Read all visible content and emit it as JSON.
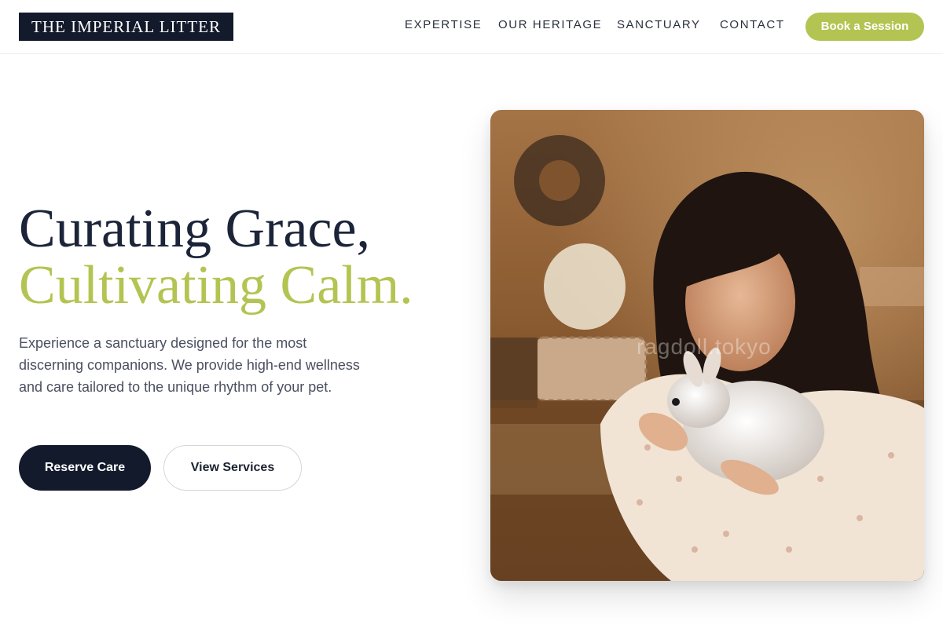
{
  "header": {
    "logo": "THE IMPERIAL LITTER",
    "nav": [
      "EXPERTISE",
      "OUR HERITAGE",
      "SANCTUARY",
      "CONTACT"
    ],
    "cta": "Book a Session"
  },
  "hero": {
    "title_line1": "Curating Grace,",
    "title_line2": "Cultivating Calm.",
    "description": "Experience a sanctuary designed for the most discerning companions. We provide high-end wellness and care tailored to the unique rhythm of your pet.",
    "primary_button": "Reserve Care",
    "secondary_button": "View Services",
    "image_watermark": "ragdoll.tokyo"
  },
  "colors": {
    "navy": "#131a2c",
    "accent": "#b4c452",
    "text_muted": "#4a5060"
  }
}
